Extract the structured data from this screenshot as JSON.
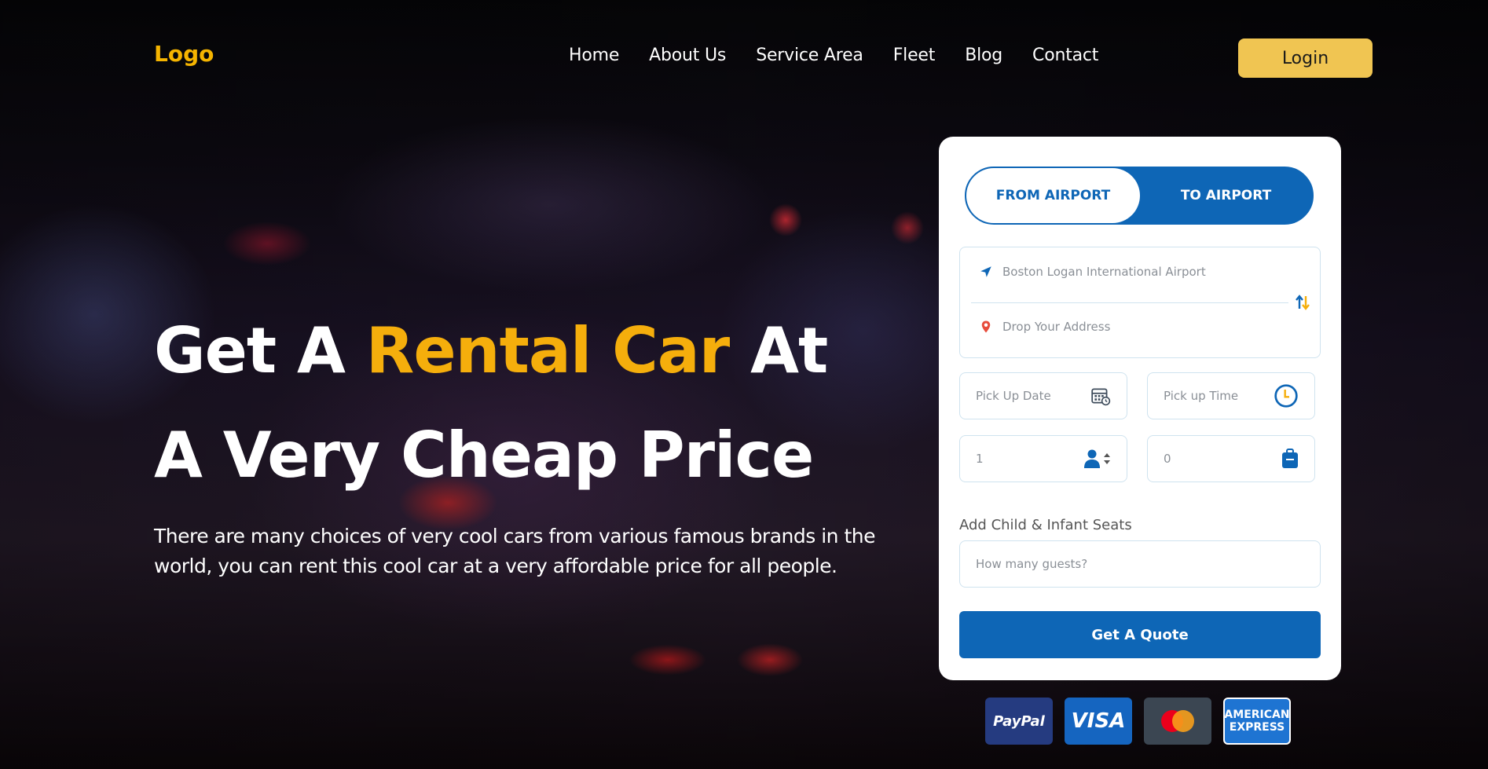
{
  "header": {
    "logo": "Logo",
    "nav": [
      "Home",
      "About Us",
      "Service Area",
      "Fleet",
      "Blog",
      "Contact"
    ],
    "login_label": "Login"
  },
  "hero": {
    "headline_part1": "Get A ",
    "headline_accent": "Rental Car",
    "headline_part2": " At",
    "headline_line2": "A Very Cheap Price",
    "description": "There are many choices of very cool cars from various famous brands in the world, you can rent this cool car at a very affordable price for all people."
  },
  "booking": {
    "tab_from": "FROM AIRPORT",
    "tab_to": "TO AIRPORT",
    "pickup_location": "Boston Logan International Airport",
    "drop_placeholder": "Drop Your Address",
    "pickup_date_placeholder": "Pick Up Date",
    "pickup_time_placeholder": "Pick up Time",
    "passengers_value": "1",
    "luggage_value": "0",
    "child_seats_label": "Add Child & Infant Seats",
    "guests_placeholder": "How many guests?",
    "quote_label": "Get A Quote"
  },
  "payments": {
    "paypal": "PayPal",
    "visa": "VISA",
    "mastercard": "",
    "amex_line1": "AMERICAN",
    "amex_line2": "EXPRESS"
  },
  "colors": {
    "accent_yellow": "#f5ae0c",
    "brand_blue": "#0e66b6",
    "login_bg": "#f0c552"
  }
}
